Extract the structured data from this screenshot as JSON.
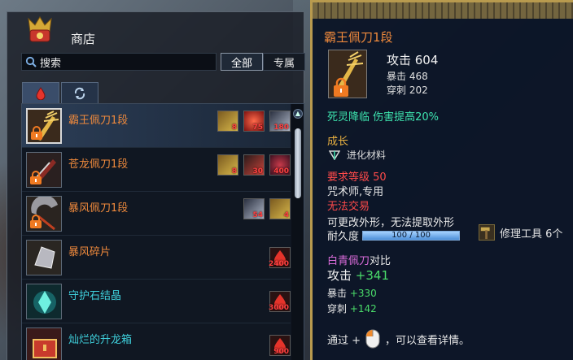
{
  "shop": {
    "title": "商店",
    "search_text": "搜索",
    "filters": [
      {
        "label": "全部",
        "active": true
      },
      {
        "label": "专属",
        "active": false
      }
    ],
    "items": [
      {
        "name": "霸王佩刀1段",
        "color": "orange",
        "selected": true,
        "costs": [
          {
            "icon": "gold-scroll-icon",
            "qty": "8"
          },
          {
            "icon": "red-orb-icon",
            "qty": "75"
          },
          {
            "icon": "silver-stone-icon",
            "qty": "180"
          }
        ]
      },
      {
        "name": "苍龙佩刀1段",
        "color": "orange",
        "selected": false,
        "costs": [
          {
            "icon": "gold-scroll-icon",
            "qty": "8"
          },
          {
            "icon": "red-shard-icon",
            "qty": "30"
          },
          {
            "icon": "red-essence-icon",
            "qty": "400"
          }
        ]
      },
      {
        "name": "暴风佩刀1段",
        "color": "orange",
        "selected": false,
        "costs": [
          {
            "icon": "silver-stone-icon",
            "qty": "54"
          },
          {
            "icon": "gold-scroll-icon",
            "qty": "4"
          }
        ]
      },
      {
        "name": "暴风碎片",
        "color": "orange",
        "selected": false,
        "costs": [
          {
            "icon": "red-flame-icon",
            "qty": "2400"
          }
        ]
      },
      {
        "name": "守护石结晶",
        "color": "cyan",
        "selected": false,
        "costs": [
          {
            "icon": "red-flame-icon",
            "qty": "3000"
          }
        ]
      },
      {
        "name": "灿烂的升龙箱",
        "color": "cyan",
        "selected": false,
        "costs": [
          {
            "icon": "red-flame-icon",
            "qty": "900"
          }
        ]
      }
    ]
  },
  "tooltip": {
    "name": "霸王佩刀1段",
    "attack": "攻击 604",
    "crit": "暴击 468",
    "pierce": "穿刺 202",
    "effect": "死灵降临 伤害提高20%",
    "growth_header": "成长",
    "growth_item": "进化材料",
    "req_level": "要求等级 50",
    "class_only": "咒术师,专用",
    "no_trade": "无法交易",
    "appearance": "可更改外形，无法提取外形",
    "durability_label": "耐久度",
    "durability_value": "100 / 100",
    "durability_fraction": 1.0,
    "repair_label": "修理工具 6个",
    "compare_item": "白青佩刀",
    "compare_suffix": "对比",
    "cmp_attack_label": "攻击",
    "cmp_attack": "+341",
    "cmp_crit_label": "暴击",
    "cmp_crit": "+330",
    "cmp_pierce_label": "穿刺",
    "cmp_pierce": "+142",
    "hint_prefix": "通过 +",
    "hint_suffix": "，可以查看详情。"
  }
}
